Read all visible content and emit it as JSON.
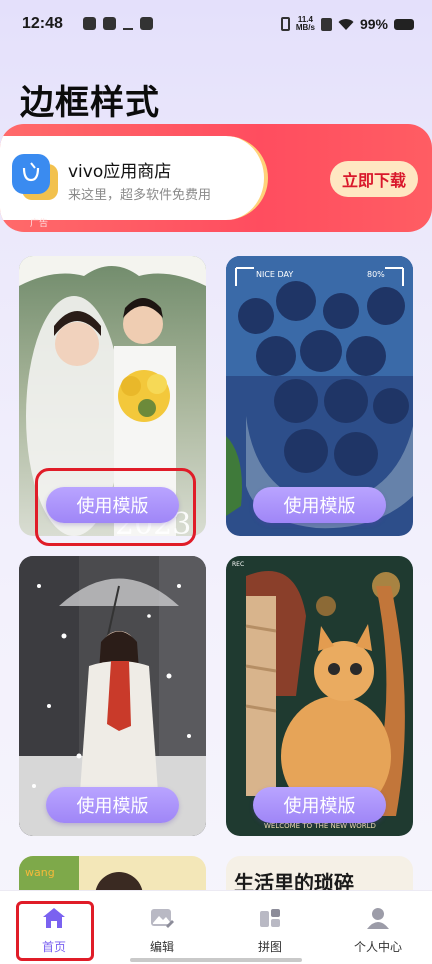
{
  "status_bar": {
    "time": "12:48",
    "net_speed_value": "11.4",
    "net_speed_unit": "MB/s",
    "battery": "99%"
  },
  "page": {
    "title": "边框样式"
  },
  "ad": {
    "app_name": "vivo应用商店",
    "description": "来这里，超多软件免费用",
    "label": "广告",
    "cta": "立即下载"
  },
  "templates": [
    {
      "button": "使用模版",
      "overlay_text": "2023"
    },
    {
      "button": "使用模版",
      "overlay_text_left": "NICE DAY",
      "overlay_text_right": "80%"
    },
    {
      "button": "使用模版"
    },
    {
      "button": "使用模版",
      "overlay_text": "WELCOME TO THE NEW WORLD",
      "badge": "REC"
    },
    {
      "overlay_text": "wang"
    },
    {
      "overlay_text": "生活里的琐碎"
    }
  ],
  "bottom_nav": {
    "items": [
      {
        "label": "首页",
        "icon": "home-icon",
        "active": true
      },
      {
        "label": "编辑",
        "icon": "edit-image-icon",
        "active": false
      },
      {
        "label": "拼图",
        "icon": "puzzle-icon",
        "active": false
      },
      {
        "label": "个人中心",
        "icon": "person-icon",
        "active": false
      }
    ]
  },
  "colors": {
    "accent": "#7a62f0",
    "button": "#a48cf8",
    "ad_bg": "#ff4d5f",
    "highlight": "#e01c28"
  }
}
